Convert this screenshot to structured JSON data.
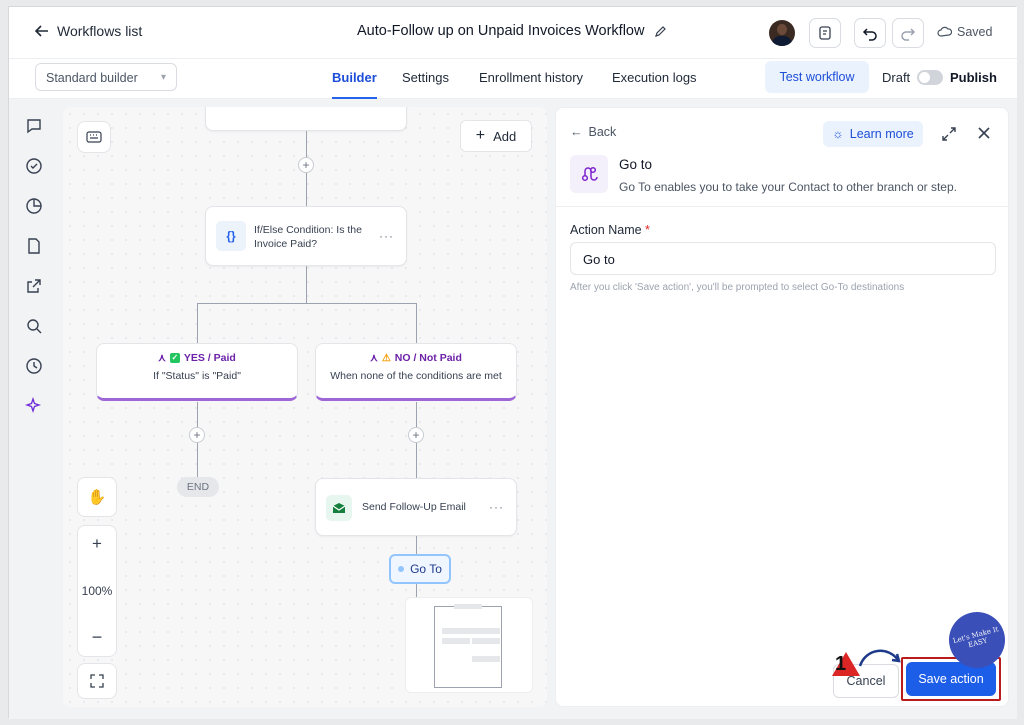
{
  "header": {
    "back_label": "Workflows list",
    "workflow_title": "Auto-Follow up on Unpaid Invoices Workflow",
    "saved_label": "Saved"
  },
  "toolbar": {
    "builder_select": "Standard builder",
    "tabs": [
      {
        "label": "Builder",
        "active": true
      },
      {
        "label": "Settings",
        "active": false
      },
      {
        "label": "Enrollment history",
        "active": false
      },
      {
        "label": "Execution logs",
        "active": false
      }
    ],
    "test_workflow_label": "Test workflow",
    "draft_label": "Draft",
    "publish_label": "Publish"
  },
  "sidebar": {
    "icons": [
      "chat-icon",
      "check-circle-icon",
      "pie-chart-icon",
      "document-icon",
      "external-link-icon",
      "search-icon",
      "clock-icon",
      "sparkles-icon"
    ]
  },
  "canvas": {
    "add_label": "Add",
    "condition_node": "If/Else Condition: Is the Invoice Paid?",
    "branch_yes": {
      "title": "YES / Paid",
      "subtitle": "If \"Status\" is \"Paid\""
    },
    "branch_no": {
      "title": "NO / Not Paid",
      "subtitle": "When none of the conditions are met"
    },
    "end_label": "END",
    "email_node": "Send Follow-Up Email",
    "goto_label": "Go To",
    "zoom_level": "100%"
  },
  "panel": {
    "back_label": "Back",
    "learn_more_label": "Learn more",
    "title": "Go to",
    "description": "Go To enables you to take your Contact to other branch or step.",
    "action_name_label": "Action Name",
    "required_mark": "*",
    "action_name_value": "Go to",
    "help_text": "After you click 'Save action', you'll be prompted to select Go-To destinations",
    "cancel_label": "Cancel",
    "save_label": "Save action"
  },
  "annotation": {
    "step_number": "1",
    "watermark_text": "Let's Make It EASY"
  },
  "colors": {
    "accent": "#1d5ee8",
    "branch_purple": "#9f67d6",
    "highlight_red": "#b91c1c"
  }
}
